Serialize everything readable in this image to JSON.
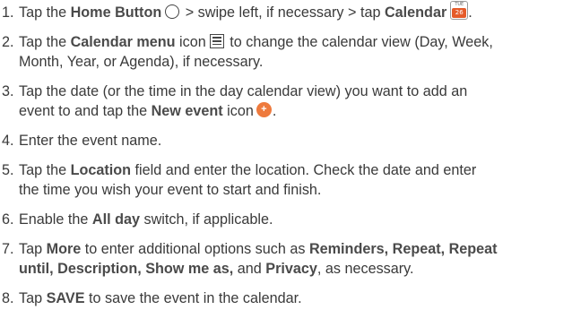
{
  "steps": [
    {
      "num": "1.",
      "t1": "Tap the ",
      "b1": "Home Button",
      "t2": " > swipe left, if necessary > tap ",
      "b2": "Calendar",
      "t3": "."
    },
    {
      "num": "2.",
      "t1": "Tap the ",
      "b1": "Calendar menu",
      "t2": " icon",
      "t3": " to change the calendar view (Day, Week,",
      "line2": "Month, Year, or Agenda), if necessary."
    },
    {
      "num": "3.",
      "line1": "Tap the date (or the time in the day calendar view) you want to add an",
      "t1": "event to and tap the ",
      "b1": "New event",
      "t2": " icon",
      "t3": "."
    },
    {
      "num": "4.",
      "line1": "Enter the event name."
    },
    {
      "num": "5.",
      "t1": "Tap the ",
      "b1": "Location",
      "t2": " field and enter the location. Check the date and enter",
      "line2": "the time you wish your event to start and finish."
    },
    {
      "num": "6.",
      "t1": "Enable the ",
      "b1": "All day",
      "t2": " switch, if applicable."
    },
    {
      "num": "7.",
      "t1": "Tap ",
      "b1": "More",
      "t2": " to enter additional options such as ",
      "b2": "Reminders, Repeat, Repeat",
      "b3": "until, Description, Show me as,",
      "t3": " and ",
      "b4": "Privacy",
      "t4": ", as necessary."
    },
    {
      "num": "8.",
      "t1": "Tap ",
      "b1": "SAVE",
      "t2": " to save the event in the calendar."
    }
  ],
  "icons": {
    "home": "home-button-circle-icon",
    "calendar": {
      "name": "calendar-app-icon",
      "day": "TUE",
      "date": "26",
      "color": "#e55b2a"
    },
    "menu": "calendar-menu-icon",
    "new_event": {
      "name": "new-event-plus-icon",
      "glyph": "+",
      "color": "#ee7a3d"
    }
  },
  "colors": {
    "text": "#3a3a3a"
  }
}
